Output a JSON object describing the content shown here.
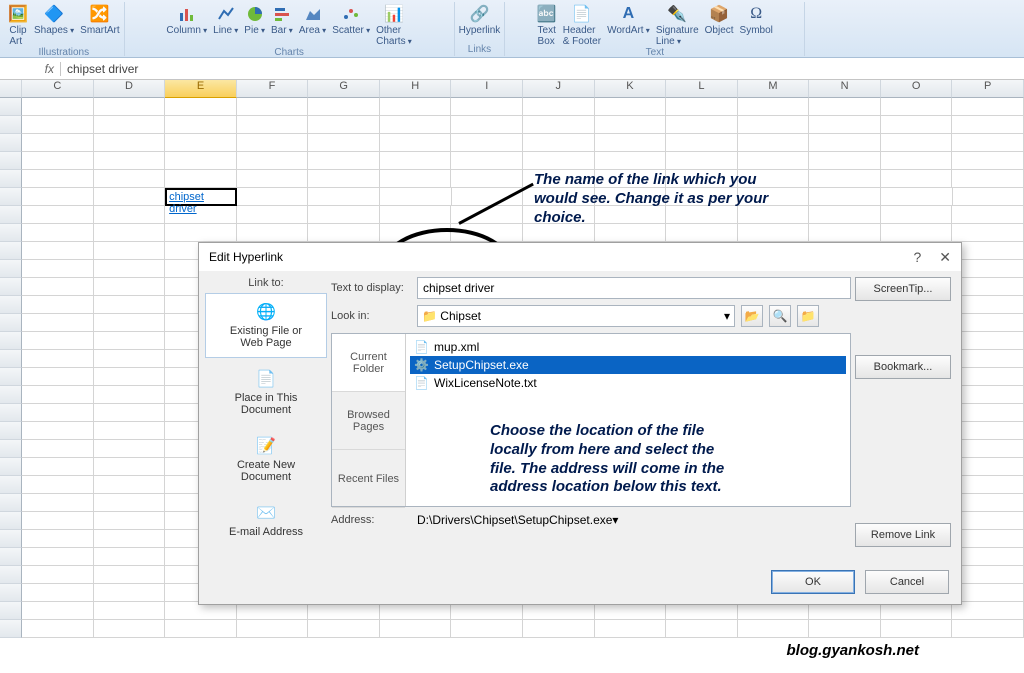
{
  "ribbon": {
    "groups": {
      "illustrations": {
        "label": "Illustrations",
        "clip": "Clip\nArt",
        "shapes": "Shapes",
        "smartart": "SmartArt"
      },
      "charts": {
        "label": "Charts",
        "column": "Column",
        "line": "Line",
        "pie": "Pie",
        "bar": "Bar",
        "area": "Area",
        "scatter": "Scatter",
        "other": "Other\nCharts"
      },
      "links": {
        "label": "Links",
        "hyperlink": "Hyperlink"
      },
      "text": {
        "label": "Text",
        "textbox": "Text\nBox",
        "hf": "Header\n& Footer",
        "wordart": "WordArt",
        "sig": "Signature\nLine",
        "object": "Object",
        "symbol": "Symbol"
      }
    }
  },
  "formula": {
    "fx": "fx",
    "value": "chipset driver"
  },
  "columns": [
    "C",
    "D",
    "E",
    "F",
    "G",
    "H",
    "I",
    "J",
    "K",
    "L",
    "M",
    "N",
    "O",
    "P"
  ],
  "cell": {
    "link_text": "chipset driver"
  },
  "dialog": {
    "title": "Edit Hyperlink",
    "link_to": "Link to:",
    "opts": {
      "existing": "Existing File or\nWeb Page",
      "place": "Place in This\nDocument",
      "createnew": "Create New\nDocument",
      "email": "E-mail Address"
    },
    "text_to_display_label": "Text to display:",
    "text_to_display": "chipset driver",
    "look_in_label": "Look in:",
    "look_in": "Chipset",
    "tabs": {
      "current": "Current\nFolder",
      "browsed": "Browsed\nPages",
      "recent": "Recent Files"
    },
    "files": {
      "mup": "mup.xml",
      "setup": "SetupChipset.exe",
      "wix": "WixLicenseNote.txt"
    },
    "address_label": "Address:",
    "address": "D:\\Drivers\\Chipset\\SetupChipset.exe",
    "buttons": {
      "screentip": "ScreenTip...",
      "bookmark": "Bookmark...",
      "remove": "Remove Link",
      "ok": "OK",
      "cancel": "Cancel"
    }
  },
  "annotations": {
    "a1": "The name of the link which you would see. Change it as per your choice.",
    "a2": "Choose the location of the file locally from here and select the file. The address will come in the address location below this text.",
    "watermark": "blog.gyankosh.net"
  }
}
